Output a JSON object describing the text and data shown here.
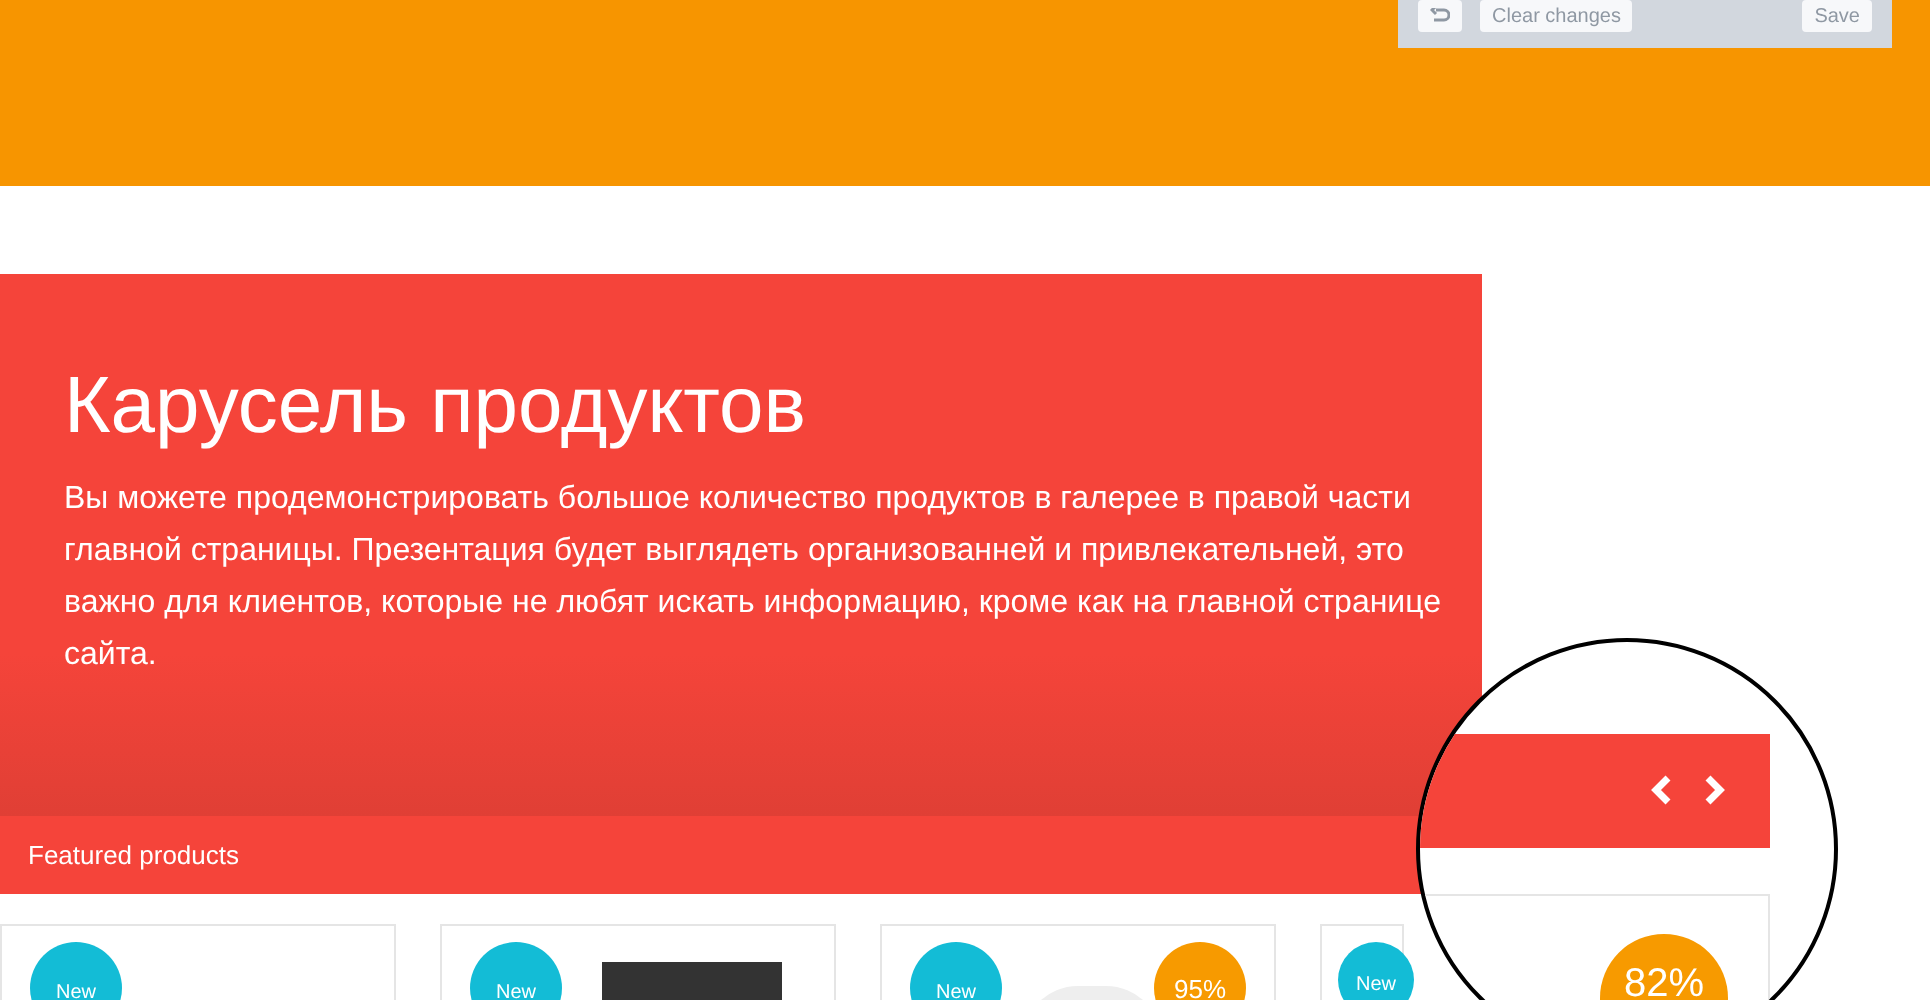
{
  "toolbar": {
    "buttons": [
      {
        "kind": "icon"
      },
      {
        "kind": "text",
        "label": "Clear changes"
      },
      {
        "kind": "text",
        "label": "Save"
      }
    ]
  },
  "hero": {
    "title": "Карусель продуктов",
    "text": "Вы можете продемонстрировать большое количество продуктов в галерее в правой части главной страницы. Презентация будет выглядеть организованней и привлекательней, это важно для клиентов, которые не любят искать информацию, кроме как на главной странице сайта."
  },
  "featured": {
    "title": "Featured products",
    "products": [
      {
        "badge": "New"
      },
      {
        "badge": "New"
      },
      {
        "badge": "New",
        "discount": "95%"
      },
      {
        "badge": "New"
      }
    ]
  },
  "magnifier": {
    "discount": "82%"
  }
}
